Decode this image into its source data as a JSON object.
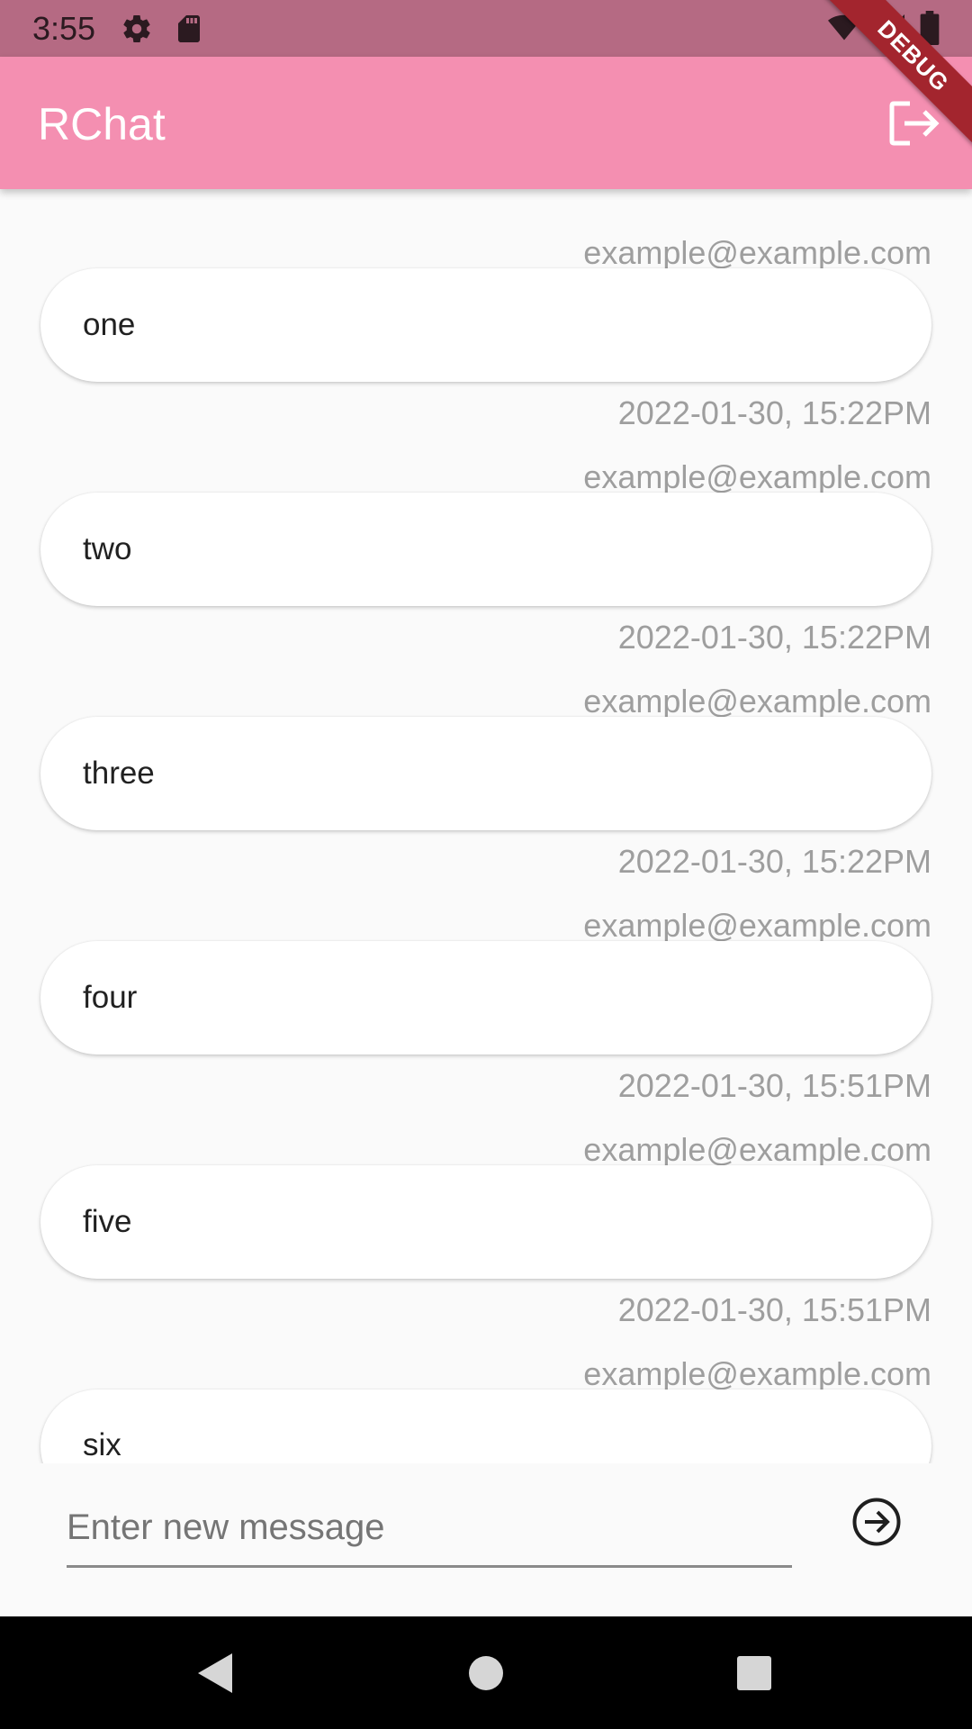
{
  "status_bar": {
    "time": "3:55",
    "icons_left": [
      "settings-icon",
      "sd-card-icon"
    ],
    "icons_right": [
      "wifi-icon",
      "signal-icon",
      "battery-icon"
    ]
  },
  "app_bar": {
    "title": "RChat",
    "logout_icon": "logout-icon"
  },
  "debug_banner": "DEBUG",
  "messages": [
    {
      "sender": "example@example.com",
      "text": "one",
      "time": "2022-01-30, 15:22PM"
    },
    {
      "sender": "example@example.com",
      "text": "two",
      "time": "2022-01-30, 15:22PM"
    },
    {
      "sender": "example@example.com",
      "text": "three",
      "time": "2022-01-30, 15:22PM"
    },
    {
      "sender": "example@example.com",
      "text": "four",
      "time": "2022-01-30, 15:51PM"
    },
    {
      "sender": "example@example.com",
      "text": "five",
      "time": "2022-01-30, 15:51PM"
    },
    {
      "sender": "example@example.com",
      "text": "six",
      "time": ""
    }
  ],
  "composer": {
    "placeholder": "Enter new message",
    "value": "",
    "send_icon": "send-icon"
  },
  "nav_bar": {
    "icons": [
      "back-icon",
      "home-icon",
      "recents-icon"
    ]
  },
  "colors": {
    "status_bar": "#b56a83",
    "app_bar": "#f48fb1",
    "background": "#fafafa",
    "debug_banner": "#a3252e"
  }
}
